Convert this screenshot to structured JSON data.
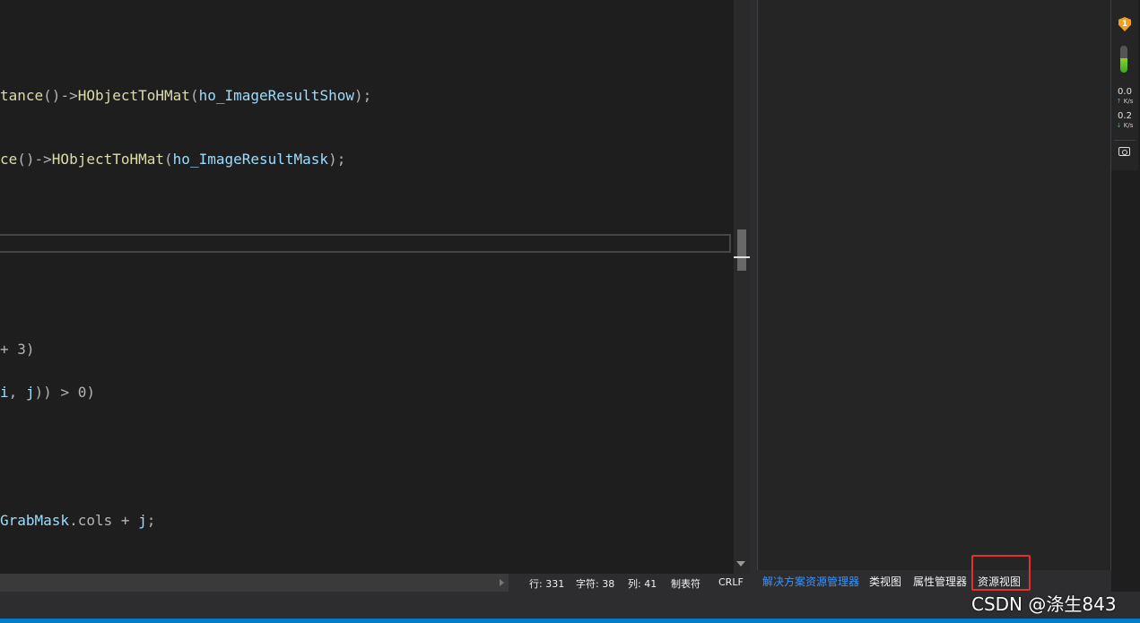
{
  "editor": {
    "lines": [
      {
        "segments": [
          {
            "t": "tance",
            "c": "fn"
          },
          {
            "t": "()->",
            "c": "punc"
          },
          {
            "t": "HObjectToHMat",
            "c": "fn"
          },
          {
            "t": "(",
            "c": "punc"
          },
          {
            "t": "ho_ImageResultShow",
            "c": "var"
          },
          {
            "t": ");",
            "c": "punc"
          }
        ]
      },
      {
        "segments": [
          {
            "t": "ce",
            "c": "fn"
          },
          {
            "t": "()->",
            "c": "punc"
          },
          {
            "t": "HObjectToHMat",
            "c": "fn"
          },
          {
            "t": "(",
            "c": "punc"
          },
          {
            "t": "ho_ImageResultMask",
            "c": "var"
          },
          {
            "t": ");",
            "c": "punc"
          }
        ]
      },
      {
        "segments": [
          {
            "t": "+ 3)",
            "c": "punc"
          }
        ]
      },
      {
        "segments": [
          {
            "t": "i",
            "c": "var"
          },
          {
            "t": ", ",
            "c": "punc"
          },
          {
            "t": "j",
            "c": "var"
          },
          {
            "t": ")) > 0)",
            "c": "punc"
          }
        ]
      },
      {
        "segments": [
          {
            "t": "GrabMask",
            "c": "var"
          },
          {
            "t": ".cols + ",
            "c": "punc"
          },
          {
            "t": "j",
            "c": "var"
          },
          {
            "t": ";",
            "c": "punc"
          }
        ]
      }
    ]
  },
  "status": {
    "line": "行: 331",
    "char": "字符: 38",
    "col": "列: 41",
    "tabs": "制表符",
    "eol": "CRLF"
  },
  "tabs": [
    {
      "label": "解决方案资源管理器",
      "active": true
    },
    {
      "label": "类视图",
      "active": false
    },
    {
      "label": "属性管理器",
      "active": false
    },
    {
      "label": "资源视图",
      "active": false
    }
  ],
  "monitor": {
    "shield_badge": "1",
    "upload_value": "0.0",
    "upload_unit": "K/s",
    "download_value": "0.2",
    "download_unit": "K/s",
    "meter_level": 0.55,
    "up_arrow": "↑",
    "down_arrow": "↓"
  },
  "watermark": "CSDN @涤生843",
  "colors": {
    "highlight_box": "#e8302a",
    "active_tab": "#3794ff",
    "accent_bar": "#007acc"
  }
}
